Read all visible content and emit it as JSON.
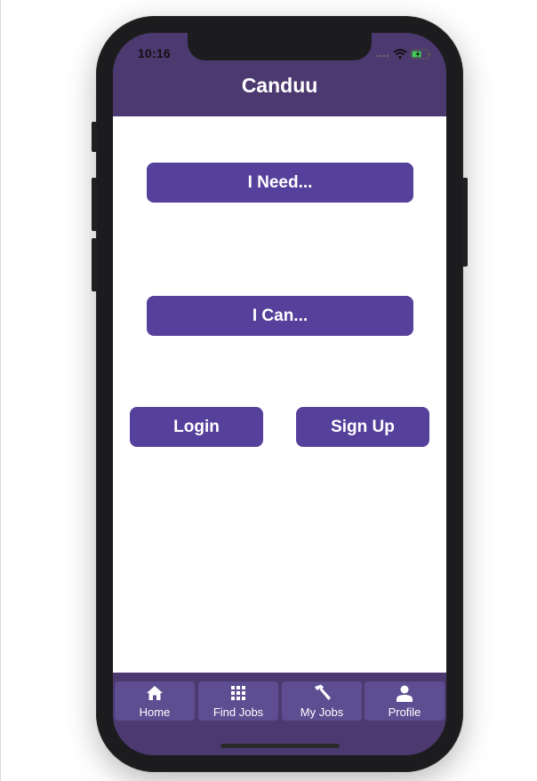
{
  "status_bar": {
    "time": "10:16"
  },
  "header": {
    "title": "Canduu"
  },
  "main": {
    "need_label": "I Need...",
    "can_label": "I Can...",
    "login_label": "Login",
    "signup_label": "Sign Up"
  },
  "tabs": [
    {
      "label": "Home",
      "icon": "home-icon"
    },
    {
      "label": "Find Jobs",
      "icon": "grid-icon"
    },
    {
      "label": "My Jobs",
      "icon": "hammer-icon"
    },
    {
      "label": "Profile",
      "icon": "person-icon"
    }
  ],
  "colors": {
    "header_bg": "#4c3970",
    "button_bg": "#55419b",
    "tab_bg": "#5d4d91",
    "text_light": "#ffffff"
  }
}
